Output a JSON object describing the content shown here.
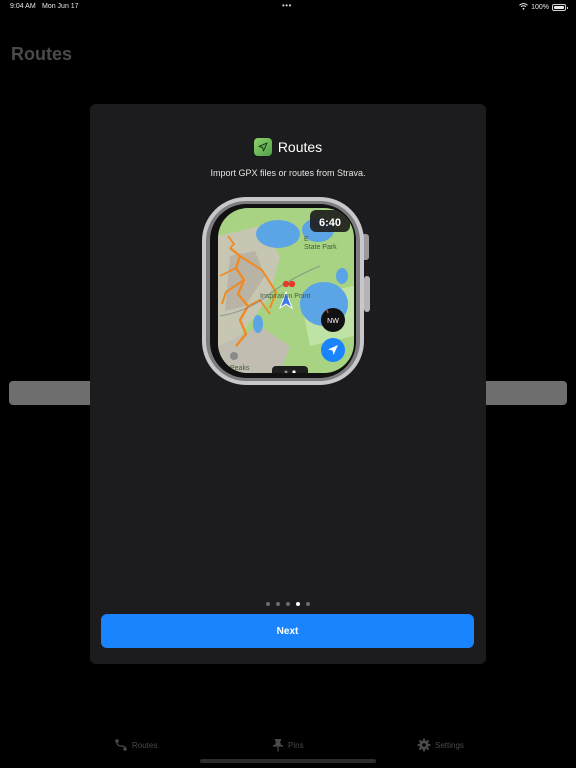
{
  "status_bar": {
    "time": "9:04 AM",
    "date": "Mon Jun 17",
    "multitask_dots": "•••",
    "battery_percent": "100%",
    "battery_level": 1.0
  },
  "background": {
    "title": "Routes"
  },
  "modal": {
    "title": "Routes",
    "subtitle": "Import GPX files or routes from Strava.",
    "app_icon": "navigation-arrow-icon",
    "watch_preview": {
      "time": "6:40",
      "park_label_line1": "E",
      "park_label_line2": "State Park",
      "point_label": "Inspiration Point",
      "peaks_label": "Peaks",
      "compass": "NW",
      "locate_icon": "location-arrow-icon",
      "page_indicator": {
        "count": 2,
        "active_index": 1
      }
    },
    "page_dots": {
      "count": 5,
      "active_index": 3
    },
    "next_label": "Next"
  },
  "tab_bar": {
    "items": [
      {
        "label": "Routes",
        "icon": "route-icon"
      },
      {
        "label": "Pins",
        "icon": "pin-icon"
      },
      {
        "label": "Settings",
        "icon": "gear-icon"
      }
    ]
  },
  "colors": {
    "accent": "#1a84ff",
    "modal_bg": "#1c1c1e",
    "map_green": "#a8d383",
    "lake_blue": "#5ba4e6",
    "route_orange": "#f08a24"
  }
}
